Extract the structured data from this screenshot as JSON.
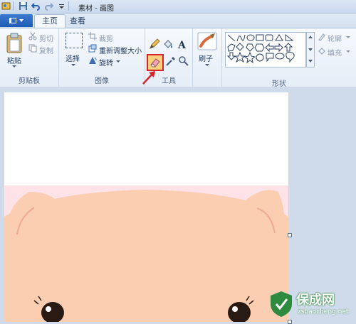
{
  "window": {
    "title": "素材 - 画图"
  },
  "tabs": [
    {
      "label": "主页",
      "active": true
    },
    {
      "label": "查看",
      "active": false
    }
  ],
  "ribbon": {
    "clipboard": {
      "paste_label": "粘贴",
      "cut_label": "剪切",
      "copy_label": "复制",
      "group_label": "剪贴板"
    },
    "image": {
      "select_label": "选择",
      "crop_label": "裁剪",
      "resize_label": "重新调整大小",
      "rotate_label": "旋转",
      "group_label": "图像"
    },
    "tools": {
      "text_glyph": "A",
      "group_label": "工具"
    },
    "brushes": {
      "label": "刷子"
    },
    "shapes": {
      "outline_label": "轮廓",
      "fill_label": "填充",
      "group_label": "形状"
    }
  },
  "colors": {
    "accent": "#1e5bb4",
    "highlight_border": "#d9232a",
    "canvas_pink": "#fde2e8",
    "pig_face": "#fbcdb1"
  },
  "watermark": {
    "title": "保成网",
    "url": "zsbaocheng.net"
  }
}
